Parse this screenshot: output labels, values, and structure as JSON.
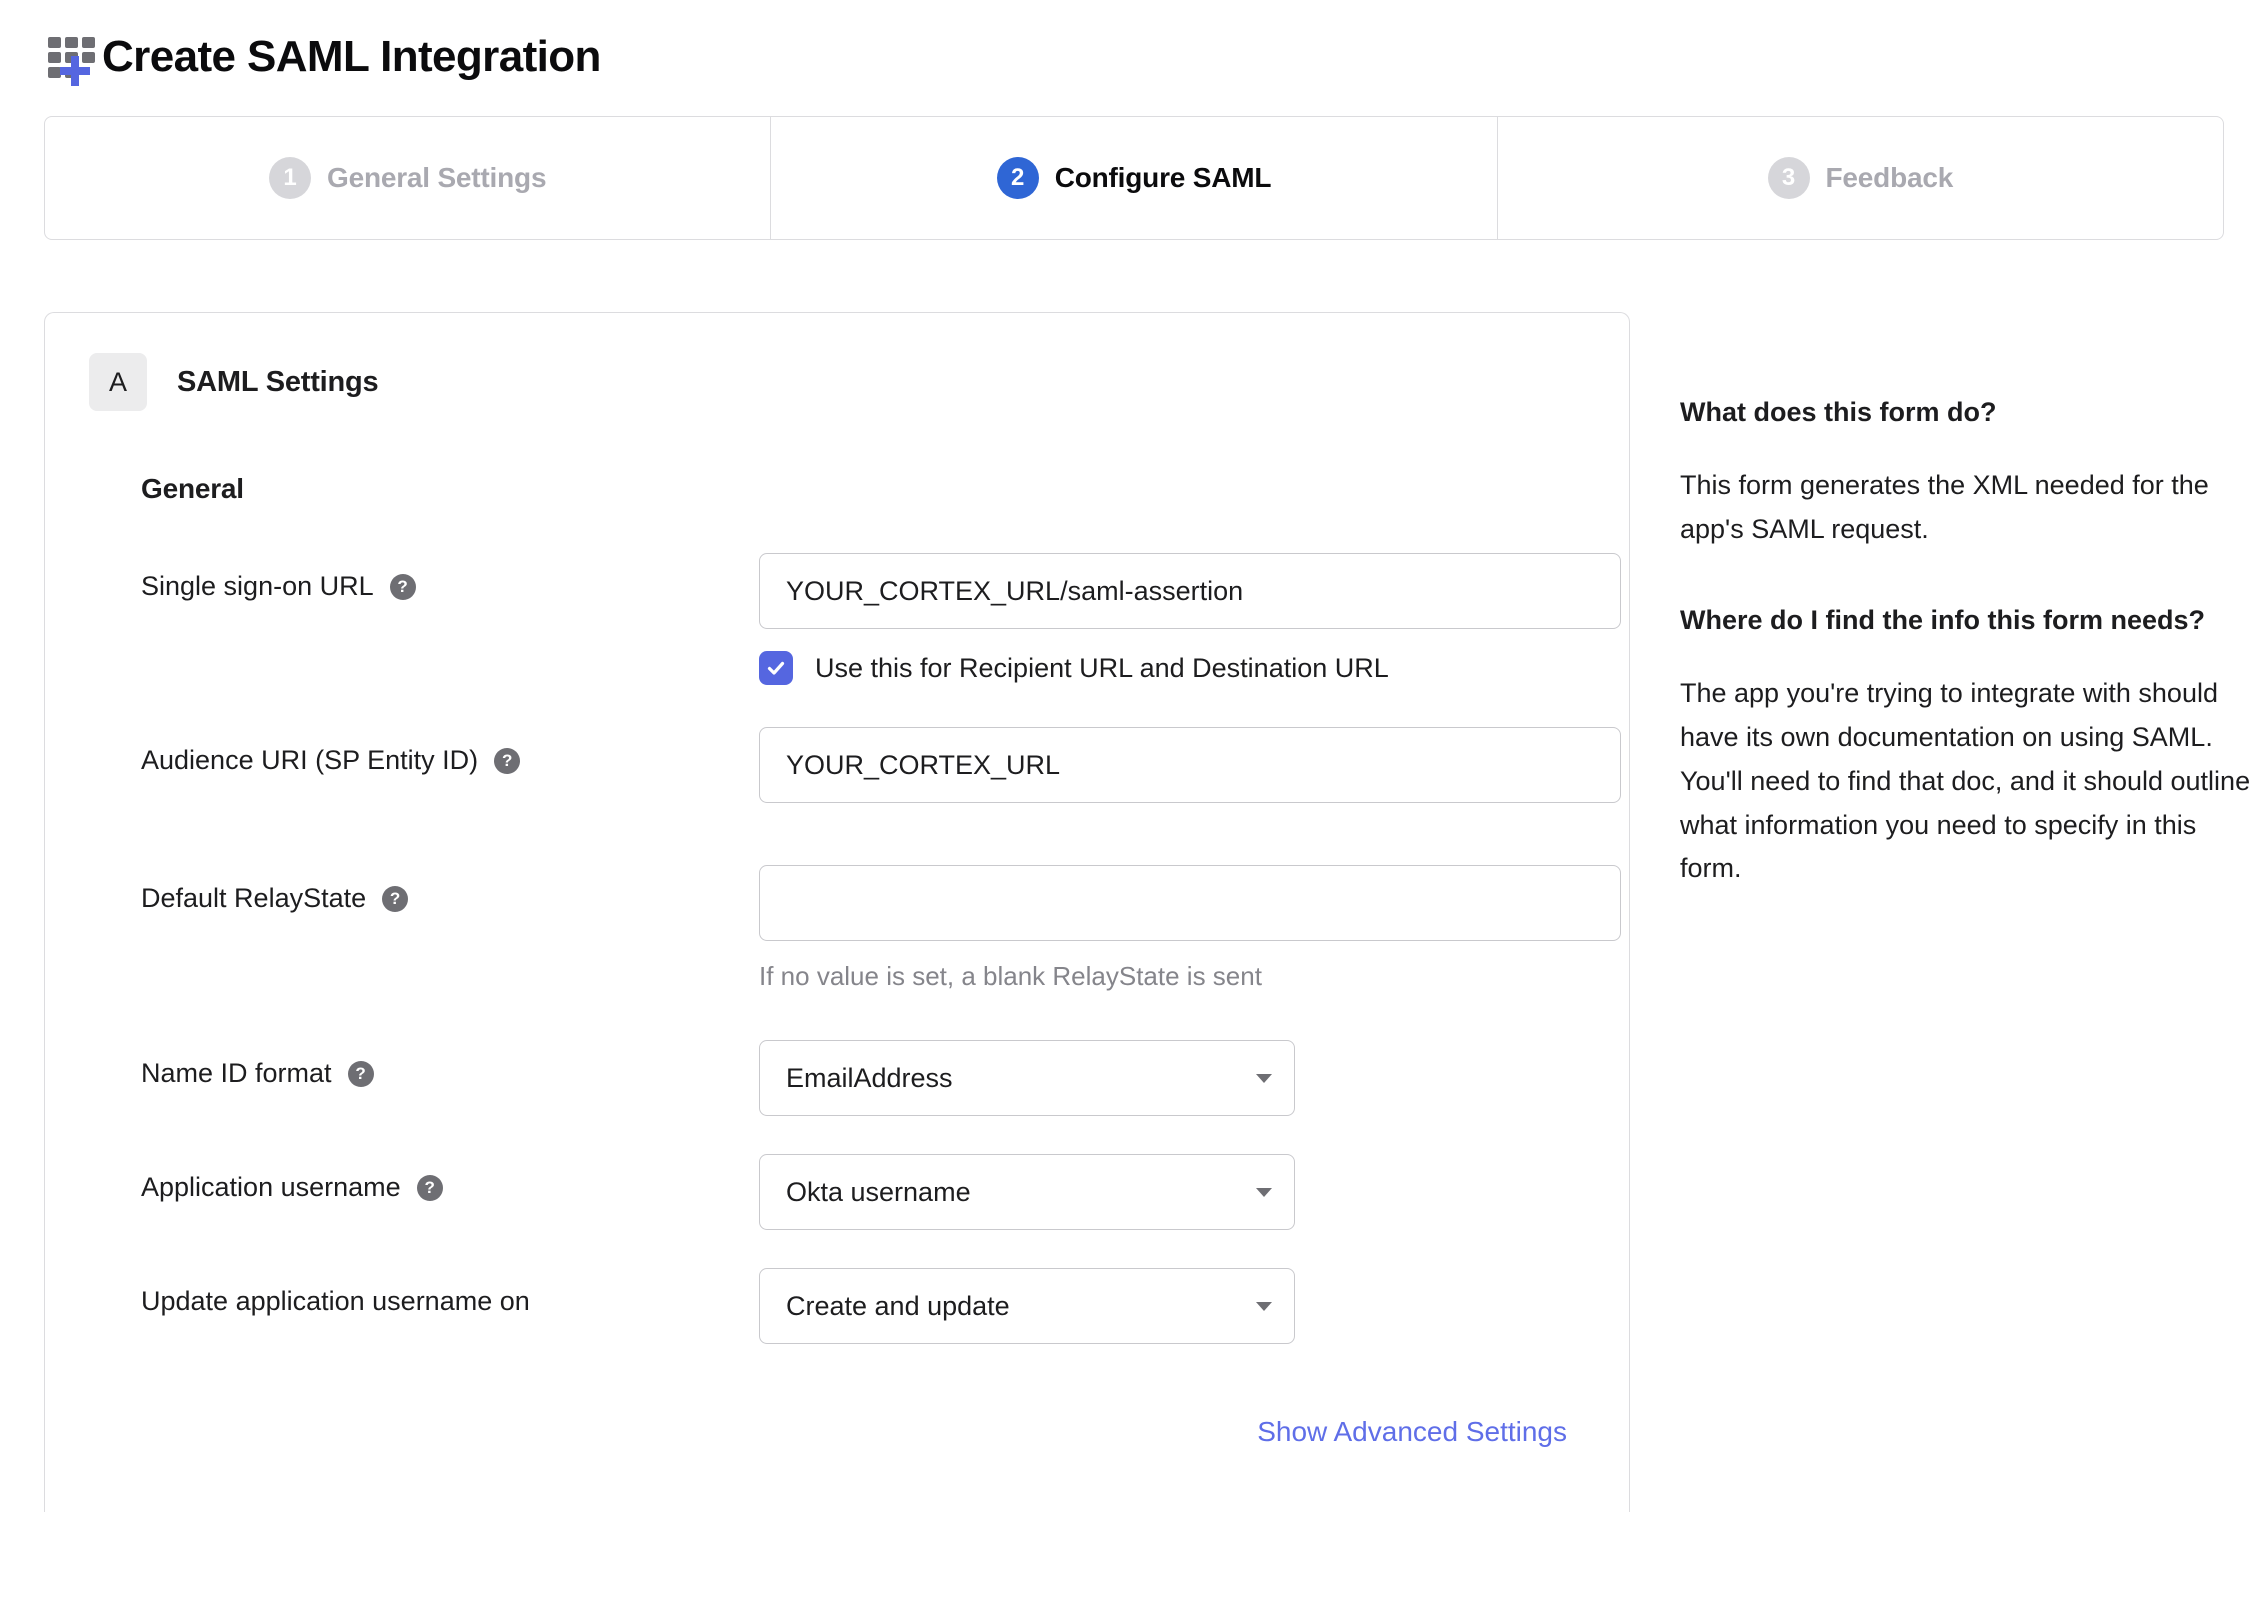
{
  "header": {
    "icon": "app-grid-plus-icon",
    "title": "Create SAML Integration"
  },
  "stepper": {
    "steps": [
      {
        "number": "1",
        "label": "General Settings",
        "active": false
      },
      {
        "number": "2",
        "label": "Configure SAML",
        "active": true
      },
      {
        "number": "3",
        "label": "Feedback",
        "active": false
      }
    ]
  },
  "card": {
    "badge": "A",
    "title": "SAML Settings",
    "group_title": "General",
    "fields": {
      "sso_url": {
        "label": "Single sign-on URL",
        "help": "?",
        "value": "YOUR_CORTEX_URL/saml-assertion",
        "checkbox_label": "Use this for Recipient URL and Destination URL",
        "checkbox_checked": true
      },
      "audience_uri": {
        "label": "Audience URI (SP Entity ID)",
        "help": "?",
        "value": "YOUR_CORTEX_URL"
      },
      "default_relaystate": {
        "label": "Default RelayState",
        "help": "?",
        "value": "",
        "hint": "If no value is set, a blank RelayState is sent"
      },
      "name_id_format": {
        "label": "Name ID format",
        "help": "?",
        "value": "EmailAddress"
      },
      "application_username": {
        "label": "Application username",
        "help": "?",
        "value": "Okta username"
      },
      "update_application_username_on": {
        "label": "Update application username on",
        "value": "Create and update"
      }
    },
    "advanced_link": "Show Advanced Settings"
  },
  "info_panel": {
    "q1_heading": "What does this form do?",
    "q1_body": "This form generates the XML needed for the app's SAML request.",
    "q2_heading": "Where do I find the info this form needs?",
    "q2_body": "The app you're trying to integrate with should have its own documentation on using SAML. You'll need to find that doc, and it should outline what information you need to specify in this form."
  },
  "colors": {
    "accent_blue": "#2f66d5",
    "link_indigo": "#5f6ee8",
    "checkbox_indigo": "#5566e0",
    "muted_grey": "#a9a9b0",
    "border_grey": "#dcdcdf"
  }
}
